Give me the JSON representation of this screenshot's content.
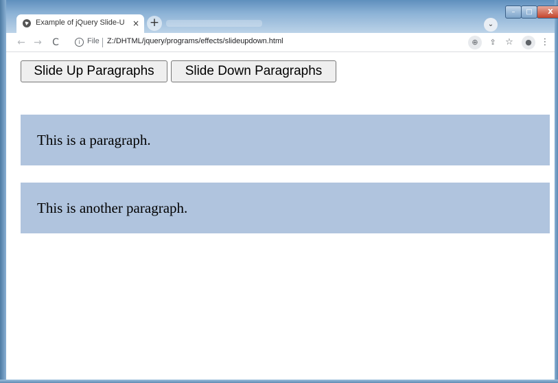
{
  "browser": {
    "tab_title": "Example of jQuery Slide-Up and",
    "tab_close": "×",
    "new_tab": "+",
    "tab_search": "⌄",
    "window_buttons": {
      "minimize": "–",
      "maximize": "□",
      "close": "X"
    },
    "nav": {
      "back": "←",
      "forward": "→",
      "reload": "C"
    },
    "address": {
      "info": "i",
      "scheme_label": "File",
      "url": "Z:/DHTML/jquery/programs/effects/slideupdown.html"
    },
    "toolbar_icons": {
      "zoom": "⊕",
      "share": "⇪",
      "star": "☆",
      "profile": "●",
      "menu": "⋮"
    }
  },
  "page": {
    "buttons": {
      "slide_up": "Slide Up Paragraphs",
      "slide_down": "Slide Down Paragraphs"
    },
    "paragraphs": [
      "This is a paragraph.",
      "This is another paragraph."
    ]
  },
  "colors": {
    "paragraph_bg": "#b0c4de",
    "button_bg": "#efefef"
  }
}
